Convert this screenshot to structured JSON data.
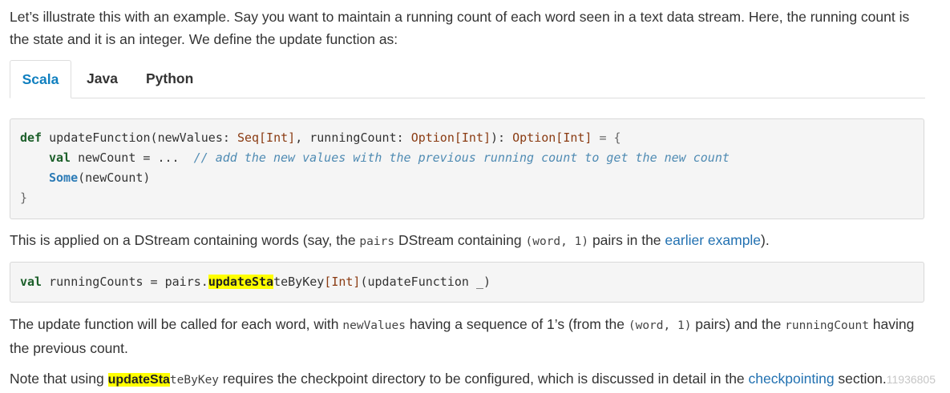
{
  "intro": {
    "line1": "Let’s illustrate this with an example. Say you want to maintain a running count of each word seen in a text data stream. Here, the running count is",
    "line2": "the state and it is an integer. We define the update function as:"
  },
  "tabs": [
    {
      "label": "Scala"
    },
    {
      "label": "Java"
    },
    {
      "label": "Python"
    }
  ],
  "code1": {
    "l1": {
      "def": "def",
      "fn": " updateFunction(newValues: ",
      "seq": "Seq[Int]",
      "mid": ", runningCount: ",
      "opt1": "Option[Int]",
      "colon": "): ",
      "opt2": "Option[Int]",
      "end": " = {"
    },
    "l2": {
      "val": "val",
      "rest": " newCount = ...  ",
      "comment": "// add the new values with the previous running count to get the new count"
    },
    "l3": {
      "some": "Some",
      "rest": "(newCount)"
    },
    "l4": "}"
  },
  "para2": {
    "a": "This is applied on a DStream containing words (say, the ",
    "code_pairs": "pairs",
    "b": " DStream containing ",
    "code_tuple": "(word, 1)",
    "c": " pairs in the ",
    "link": "earlier example",
    "d": ")."
  },
  "code2": {
    "val": "val",
    "a": " runningCounts = pairs.",
    "hl": "updateSta",
    "b": "teByKey",
    "ty": "[Int]",
    "c": "(updateFunction _)"
  },
  "para3": {
    "a": "The update function will be called for each word, with ",
    "code_nv": "newValues",
    "b": " having a sequence of 1’s (from the ",
    "code_tuple": "(word, 1)",
    "c": " pairs) and the ",
    "code_rc": "runningCount",
    "d": " having",
    "line2": "the previous count."
  },
  "para4": {
    "a": "Note that using ",
    "hl": "updateSta",
    "code_rest": "teByKey",
    "b": " requires the checkpoint directory to be configured, which is discussed in detail in the ",
    "link": "checkpointing",
    "c": " section.",
    "watermark": "11936805"
  }
}
